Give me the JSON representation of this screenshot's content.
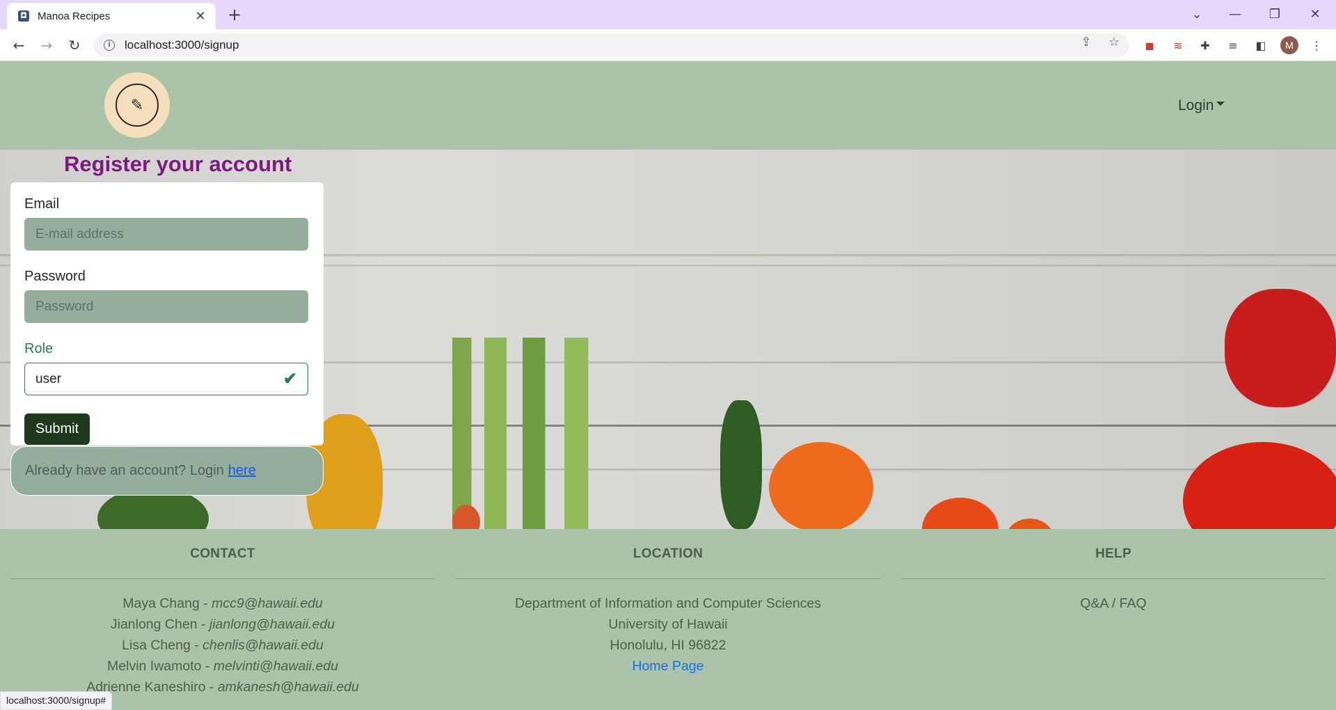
{
  "browser": {
    "tab_title": "Manoa Recipes",
    "url": "localhost:3000/signup",
    "profile_initial": "M",
    "status_url": "localhost:3000/signup#"
  },
  "navbar": {
    "login_label": "Login"
  },
  "page": {
    "title": "Register your account"
  },
  "form": {
    "email_label": "Email",
    "email_placeholder": "E-mail address",
    "password_label": "Password",
    "password_placeholder": "Password",
    "role_label": "Role",
    "role_value": "user",
    "submit_label": "Submit"
  },
  "login_prompt": {
    "text": "Already have an account? Login",
    "link": "here"
  },
  "footer": {
    "contact": {
      "heading": "CONTACT",
      "people": [
        {
          "name": "Maya Chang - ",
          "email": "mcc9@hawaii.edu"
        },
        {
          "name": "Jianlong Chen - ",
          "email": "jianlong@hawaii.edu"
        },
        {
          "name": "Lisa Cheng - ",
          "email": "chenlis@hawaii.edu"
        },
        {
          "name": "Melvin Iwamoto - ",
          "email": "melvinti@hawaii.edu"
        },
        {
          "name": "Adrienne Kaneshiro - ",
          "email": "amkanesh@hawaii.edu"
        }
      ]
    },
    "location": {
      "heading": "LOCATION",
      "lines": [
        "Department of Information and Computer Sciences",
        "University of Hawaii",
        "Honolulu, HI 96822"
      ],
      "home_link": "Home Page"
    },
    "help": {
      "heading": "HELP",
      "link": "Q&A / FAQ"
    }
  }
}
